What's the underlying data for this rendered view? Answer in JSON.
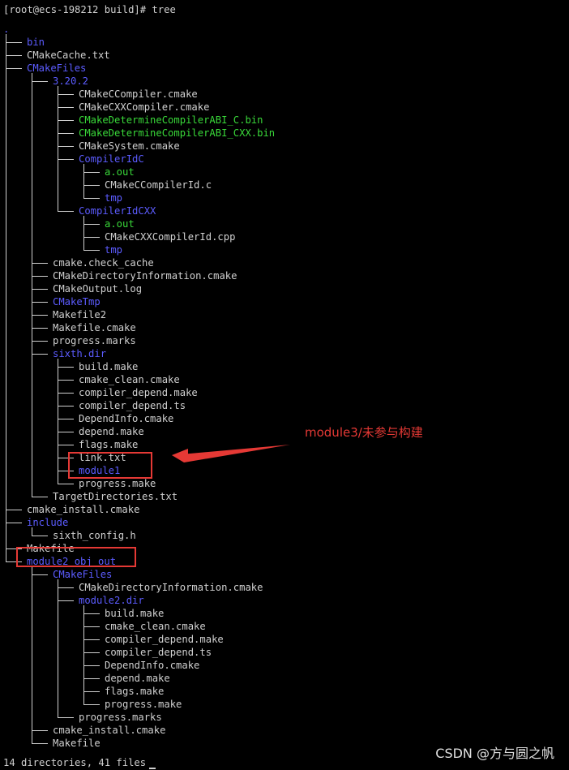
{
  "prompt": {
    "text": "[root@ecs-198212 build]# tree"
  },
  "tree": [
    {
      "depth": 0,
      "name": ".",
      "kind": "dir",
      "last": false,
      "root": true
    },
    {
      "depth": 1,
      "name": "bin",
      "kind": "dir"
    },
    {
      "depth": 1,
      "name": "CMakeCache.txt",
      "kind": "file"
    },
    {
      "depth": 1,
      "name": "CMakeFiles",
      "kind": "dir"
    },
    {
      "depth": 2,
      "name": "3.20.2",
      "kind": "dir"
    },
    {
      "depth": 3,
      "name": "CMakeCCompiler.cmake",
      "kind": "file"
    },
    {
      "depth": 3,
      "name": "CMakeCXXCompiler.cmake",
      "kind": "file"
    },
    {
      "depth": 3,
      "name": "CMakeDetermineCompilerABI_C.bin",
      "kind": "exec"
    },
    {
      "depth": 3,
      "name": "CMakeDetermineCompilerABI_CXX.bin",
      "kind": "exec"
    },
    {
      "depth": 3,
      "name": "CMakeSystem.cmake",
      "kind": "file"
    },
    {
      "depth": 3,
      "name": "CompilerIdC",
      "kind": "dir"
    },
    {
      "depth": 4,
      "name": "a.out",
      "kind": "exec"
    },
    {
      "depth": 4,
      "name": "CMakeCCompilerId.c",
      "kind": "file"
    },
    {
      "depth": 4,
      "name": "tmp",
      "kind": "dir"
    },
    {
      "depth": 3,
      "name": "CompilerIdCXX",
      "kind": "dir"
    },
    {
      "depth": 4,
      "name": "a.out",
      "kind": "exec"
    },
    {
      "depth": 4,
      "name": "CMakeCXXCompilerId.cpp",
      "kind": "file"
    },
    {
      "depth": 4,
      "name": "tmp",
      "kind": "dir"
    },
    {
      "depth": 2,
      "name": "cmake.check_cache",
      "kind": "file"
    },
    {
      "depth": 2,
      "name": "CMakeDirectoryInformation.cmake",
      "kind": "file"
    },
    {
      "depth": 2,
      "name": "CMakeOutput.log",
      "kind": "file"
    },
    {
      "depth": 2,
      "name": "CMakeTmp",
      "kind": "dir"
    },
    {
      "depth": 2,
      "name": "Makefile2",
      "kind": "file"
    },
    {
      "depth": 2,
      "name": "Makefile.cmake",
      "kind": "file"
    },
    {
      "depth": 2,
      "name": "progress.marks",
      "kind": "file"
    },
    {
      "depth": 2,
      "name": "sixth.dir",
      "kind": "dir"
    },
    {
      "depth": 3,
      "name": "build.make",
      "kind": "file"
    },
    {
      "depth": 3,
      "name": "cmake_clean.cmake",
      "kind": "file"
    },
    {
      "depth": 3,
      "name": "compiler_depend.make",
      "kind": "file"
    },
    {
      "depth": 3,
      "name": "compiler_depend.ts",
      "kind": "file"
    },
    {
      "depth": 3,
      "name": "DependInfo.cmake",
      "kind": "file"
    },
    {
      "depth": 3,
      "name": "depend.make",
      "kind": "file"
    },
    {
      "depth": 3,
      "name": "flags.make",
      "kind": "file"
    },
    {
      "depth": 3,
      "name": "link.txt",
      "kind": "file"
    },
    {
      "depth": 3,
      "name": "module1",
      "kind": "dir"
    },
    {
      "depth": 3,
      "name": "progress.make",
      "kind": "file"
    },
    {
      "depth": 2,
      "name": "TargetDirectories.txt",
      "kind": "file"
    },
    {
      "depth": 1,
      "name": "cmake_install.cmake",
      "kind": "file"
    },
    {
      "depth": 1,
      "name": "include",
      "kind": "dir"
    },
    {
      "depth": 2,
      "name": "sixth_config.h",
      "kind": "file"
    },
    {
      "depth": 1,
      "name": "Makefile",
      "kind": "file"
    },
    {
      "depth": 1,
      "name": "module2_obj_out",
      "kind": "dir"
    },
    {
      "depth": 2,
      "name": "CMakeFiles",
      "kind": "dir"
    },
    {
      "depth": 3,
      "name": "CMakeDirectoryInformation.cmake",
      "kind": "file"
    },
    {
      "depth": 3,
      "name": "module2.dir",
      "kind": "dir"
    },
    {
      "depth": 4,
      "name": "build.make",
      "kind": "file"
    },
    {
      "depth": 4,
      "name": "cmake_clean.cmake",
      "kind": "file"
    },
    {
      "depth": 4,
      "name": "compiler_depend.make",
      "kind": "file"
    },
    {
      "depth": 4,
      "name": "compiler_depend.ts",
      "kind": "file"
    },
    {
      "depth": 4,
      "name": "DependInfo.cmake",
      "kind": "file"
    },
    {
      "depth": 4,
      "name": "depend.make",
      "kind": "file"
    },
    {
      "depth": 4,
      "name": "flags.make",
      "kind": "file"
    },
    {
      "depth": 4,
      "name": "progress.make",
      "kind": "file"
    },
    {
      "depth": 3,
      "name": "progress.marks",
      "kind": "file"
    },
    {
      "depth": 2,
      "name": "cmake_install.cmake",
      "kind": "file"
    },
    {
      "depth": 2,
      "name": "Makefile",
      "kind": "file"
    }
  ],
  "summary": {
    "text": "14 directories, 41 files"
  },
  "annotation": {
    "text": "module3/未参与构建",
    "color": "#e53935"
  },
  "watermark": {
    "text": "CSDN @方与圆之帆"
  },
  "colors": {
    "background": "#000000",
    "text": "#d0d0d0",
    "directory": "#5c5cff",
    "executable": "#39d839",
    "annotation": "#e53935"
  }
}
